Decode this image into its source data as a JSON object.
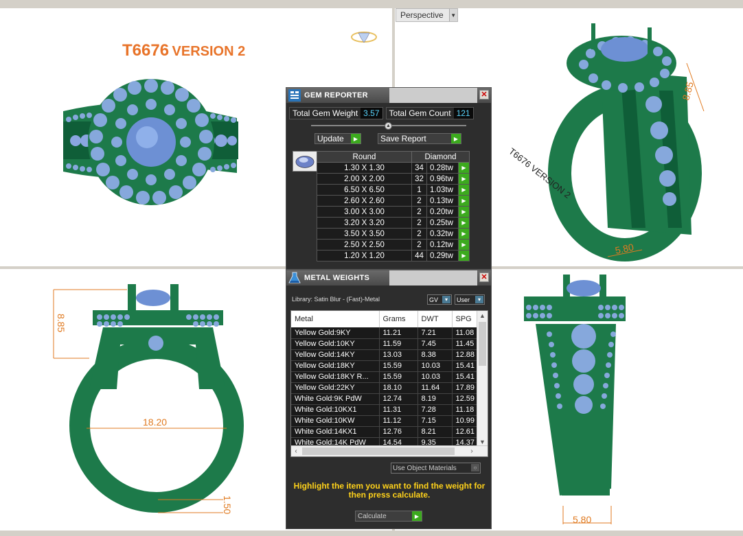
{
  "viewport": {
    "perspective_label": "Perspective"
  },
  "ring": {
    "title_code": "T6676",
    "title_version": "VERSION 2",
    "engraving": "T6676 VERSION 2",
    "dims": {
      "height_top_right": "8.85",
      "shank_top_right": "5.80",
      "height_front": "8.85",
      "inner_diameter": "18.20",
      "shank_thickness": "1.50",
      "shank_side": "5.80"
    }
  },
  "gem_reporter": {
    "title": "GEM REPORTER",
    "total_weight_label": "Total Gem Weight",
    "total_weight_value": "3.57",
    "total_count_label": "Total Gem Count",
    "total_count_value": "121",
    "update_label": "Update",
    "save_label": "Save Report",
    "col_shape": "Round",
    "col_material": "Diamond",
    "rows": [
      {
        "size": "1.30 X 1.30",
        "count": "34",
        "weight": "0.28tw"
      },
      {
        "size": "2.00 X 2.00",
        "count": "32",
        "weight": "0.96tw"
      },
      {
        "size": "6.50 X 6.50",
        "count": "1",
        "weight": "1.03tw"
      },
      {
        "size": "2.60 X 2.60",
        "count": "2",
        "weight": "0.13tw"
      },
      {
        "size": "3.00 X 3.00",
        "count": "2",
        "weight": "0.20tw"
      },
      {
        "size": "3.20 X 3.20",
        "count": "2",
        "weight": "0.25tw"
      },
      {
        "size": "3.50 X 3.50",
        "count": "2",
        "weight": "0.32tw"
      },
      {
        "size": "2.50 X 2.50",
        "count": "2",
        "weight": "0.12tw"
      },
      {
        "size": "1.20 X 1.20",
        "count": "44",
        "weight": "0.29tw"
      }
    ]
  },
  "metal_weights": {
    "title": "METAL WEIGHTS",
    "library": "Library: Satin Blur - (Fast)-Metal",
    "gv_label": "GV",
    "user_label": "User",
    "columns": [
      "Metal",
      "Grams",
      "DWT",
      "SPG"
    ],
    "rows": [
      [
        "Yellow Gold:9KY",
        "11.21",
        "7.21",
        "11.08"
      ],
      [
        "Yellow Gold:10KY",
        "11.59",
        "7.45",
        "11.45"
      ],
      [
        "Yellow Gold:14KY",
        "13.03",
        "8.38",
        "12.88"
      ],
      [
        "Yellow Gold:18KY",
        "15.59",
        "10.03",
        "15.41"
      ],
      [
        "Yellow Gold:18KY R...",
        "15.59",
        "10.03",
        "15.41"
      ],
      [
        "Yellow Gold:22KY",
        "18.10",
        "11.64",
        "17.89"
      ],
      [
        "White Gold:9K PdW",
        "12.74",
        "8.19",
        "12.59"
      ],
      [
        "White Gold:10KX1",
        "11.31",
        "7.28",
        "11.18"
      ],
      [
        "White Gold:10KW",
        "11.12",
        "7.15",
        "10.99"
      ],
      [
        "White Gold:14KX1",
        "12.76",
        "8.21",
        "12.61"
      ],
      [
        "White Gold:14K PdW",
        "14.54",
        "9.35",
        "14.37"
      ]
    ],
    "use_object_label": "Use Object Materials",
    "hint": "Highlight the item you want to find the weight for then press calculate.",
    "calculate_label": "Calculate"
  }
}
